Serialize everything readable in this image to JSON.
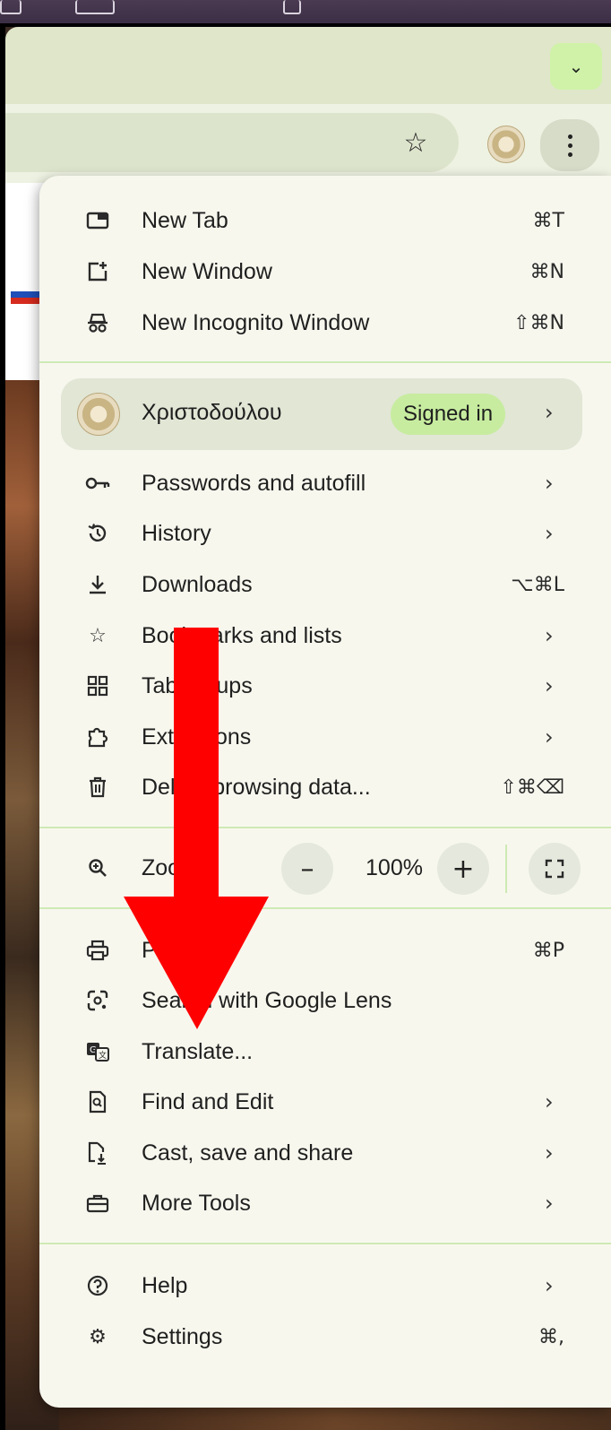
{
  "colors": {
    "menu_background": "#f7f7ee",
    "divider": "#cfeab5",
    "signed_in_badge": "#c7ec9f",
    "annotation_arrow": "#ff0000"
  },
  "toolbar": {
    "tab_dropdown_icon": "chevron-down-icon",
    "bookmark_icon": "star-icon",
    "menu_icon": "kebab-icon"
  },
  "menu": {
    "group1": [
      {
        "label": "New Tab",
        "shortcut": "⌘T",
        "icon": "new-tab-icon"
      },
      {
        "label": "New Window",
        "shortcut": "⌘N",
        "icon": "new-window-icon"
      },
      {
        "label": "New Incognito Window",
        "shortcut": "⇧⌘N",
        "icon": "incognito-icon"
      }
    ],
    "profile": {
      "name": "Χριστοδούλου",
      "status": "Signed in"
    },
    "group2": [
      {
        "label": "Passwords and autofill",
        "icon": "key-icon"
      },
      {
        "label": "History",
        "icon": "history-icon"
      },
      {
        "label": "Downloads",
        "shortcut": "⌥⌘L",
        "icon": "download-icon"
      },
      {
        "label": "Bookmarks and lists",
        "icon": "star-icon"
      },
      {
        "label": "Tab groups",
        "icon": "tab-groups-icon"
      },
      {
        "label": "Extensions",
        "icon": "puzzle-icon"
      },
      {
        "label": "Delete browsing data...",
        "shortcut": "⇧⌘⌫",
        "icon": "trash-icon"
      }
    ],
    "zoom": {
      "label": "Zoom",
      "value": "100%",
      "minus": "–",
      "plus": "+"
    },
    "group3": [
      {
        "label": "Print...",
        "shortcut": "⌘P",
        "icon": "print-icon"
      },
      {
        "label": "Search with Google Lens",
        "icon": "lens-icon"
      },
      {
        "label": "Translate...",
        "icon": "translate-icon"
      },
      {
        "label": "Find and Edit",
        "icon": "find-icon"
      },
      {
        "label": "Cast, save and share",
        "icon": "cast-icon"
      },
      {
        "label": "More Tools",
        "icon": "toolbox-icon"
      }
    ],
    "group4": [
      {
        "label": "Help",
        "icon": "help-icon"
      },
      {
        "label": "Settings",
        "shortcut": "⌘,",
        "icon": "settings-icon"
      }
    ]
  }
}
